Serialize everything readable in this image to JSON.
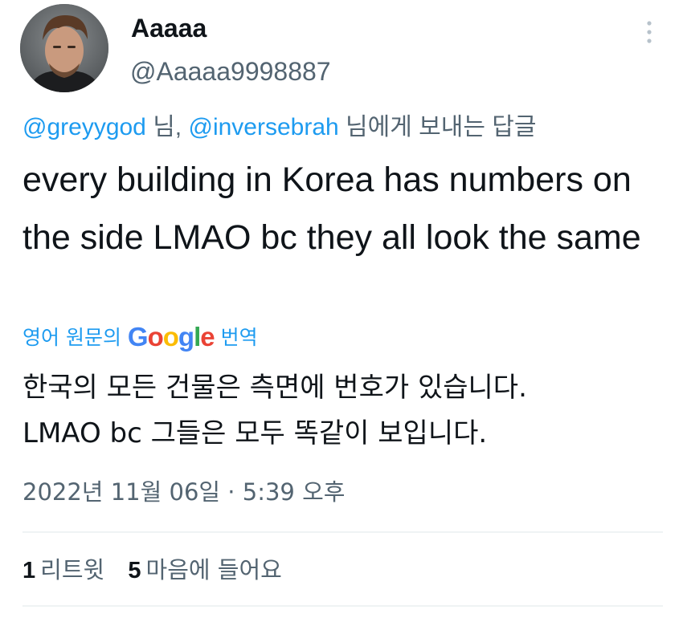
{
  "author": {
    "display_name": "Aaaaa",
    "handle": "@Aaaaa9998887"
  },
  "reply_context": {
    "mention_1": "@greyygod",
    "separator": " 님, ",
    "mention_2": "@inversebrah",
    "suffix": " 님에게 보내는 답글"
  },
  "tweet": {
    "text": "every building in Korea has numbers on the side LMAO bc they all look the same"
  },
  "translation": {
    "prefix": "영어 원문의 ",
    "google_letters": [
      "G",
      "o",
      "o",
      "g",
      "l",
      "e"
    ],
    "suffix": " 번역",
    "text": "한국의 모든 건물은 측면에 번호가 있습니다.\nLMAO bc 그들은 모두 똑같이 보입니다."
  },
  "timestamp": "2022년 11월 06일 · 5:39 오후",
  "stats": {
    "retweets_count": "1",
    "retweets_label": "리트윗",
    "likes_count": "5",
    "likes_label": "마음에 들어요"
  },
  "icons": {
    "more": "more-vertical-icon"
  },
  "colors": {
    "link": "#1d9bf0",
    "secondary_text": "#536471",
    "primary_text": "#0f1419",
    "divider": "#eff3f4"
  }
}
